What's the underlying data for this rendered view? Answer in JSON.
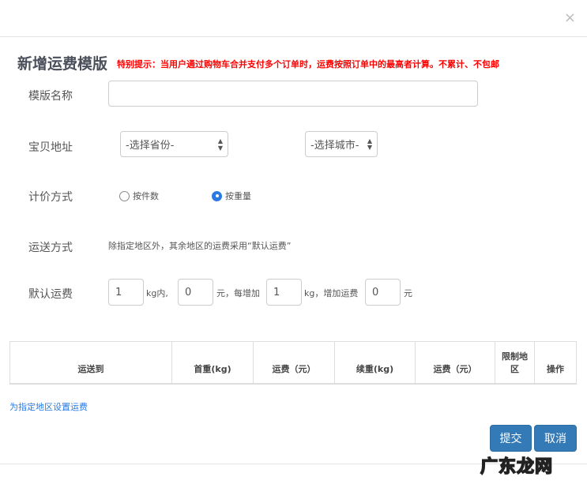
{
  "dialog": {
    "close": "×",
    "title": "新增运费模版",
    "tip": "特别提示：当用户通过购物车合并支付多个订单时，运费按照订单中的最高者计算。不累计、不包邮"
  },
  "form": {
    "name_label": "模版名称",
    "name_value": "",
    "address_label": "宝贝地址",
    "province": "-选择省份-",
    "city": "-选择城市-",
    "pricing_label": "计价方式",
    "pricing_options": [
      {
        "label": "按件数",
        "checked": false
      },
      {
        "label": "按重量",
        "checked": true
      }
    ],
    "shipping_label": "运送方式",
    "shipping_desc": "除指定地区外，其余地区的运费采用“默认运费”",
    "default_label": "默认运费",
    "first_weight": "1",
    "t1": "kg内,",
    "first_fee": "0",
    "t2": "元，每增加",
    "add_weight": "1",
    "t3": "kg，增加运费",
    "add_fee": "0",
    "t4": "元"
  },
  "table": {
    "headers": [
      "运送到",
      "首重(kg)",
      "运费（元）",
      "续重(kg)",
      "运费（元）",
      "限制地区",
      "操作"
    ]
  },
  "link": "为指定地区设置运费",
  "buttons": {
    "submit": "提交",
    "cancel": "取消"
  },
  "watermark": "广东龙网"
}
